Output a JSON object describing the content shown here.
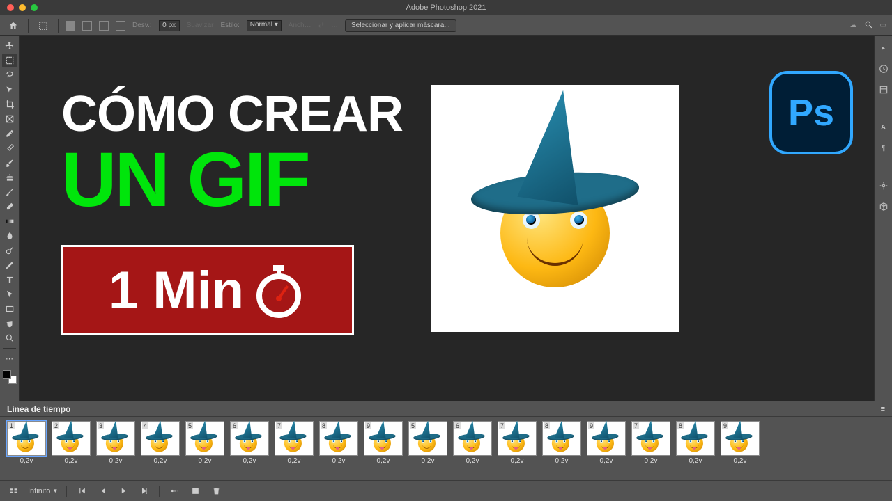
{
  "app_title": "Adobe Photoshop 2021",
  "options_bar": {
    "desv_label": "Desv.:",
    "desv_value": "0 px",
    "suavizar": "Suavizar",
    "estilo_label": "Estilo:",
    "estilo_value": "Normal",
    "anch_label": "Anch…",
    "mask_button": "Seleccionar y aplicar máscara..."
  },
  "overlay": {
    "line1": "CÓMO CREAR",
    "line2": "UN GIF",
    "badge": "1 Min",
    "ps_logo": "Ps"
  },
  "right_panel_icons": [
    "history",
    "properties",
    "type",
    "paragraph",
    "navigator",
    "3d"
  ],
  "timeline": {
    "title": "Línea de tiempo",
    "frames": [
      {
        "n": "1",
        "delay": "0,2v",
        "sel": true,
        "tongue": false
      },
      {
        "n": "2",
        "delay": "0,2v",
        "tongue": true
      },
      {
        "n": "3",
        "delay": "0,2v",
        "tongue": true
      },
      {
        "n": "4",
        "delay": "0,2v",
        "tongue": false
      },
      {
        "n": "5",
        "delay": "0,2v",
        "tongue": true
      },
      {
        "n": "6",
        "delay": "0,2v",
        "tongue": true
      },
      {
        "n": "7",
        "delay": "0,2v",
        "tongue": true
      },
      {
        "n": "8",
        "delay": "0,2v",
        "tongue": true
      },
      {
        "n": "9",
        "delay": "0,2v",
        "tongue": true
      },
      {
        "n": "5",
        "delay": "0,2v",
        "tongue": false
      },
      {
        "n": "6",
        "delay": "0,2v",
        "tongue": true
      },
      {
        "n": "7",
        "delay": "0,2v",
        "tongue": true
      },
      {
        "n": "8",
        "delay": "0,2v",
        "tongue": true
      },
      {
        "n": "9",
        "delay": "0,2v",
        "tongue": true
      },
      {
        "n": "7",
        "delay": "0,2v",
        "tongue": true
      },
      {
        "n": "8",
        "delay": "0,2v",
        "tongue": true
      },
      {
        "n": "9",
        "delay": "0,2v",
        "tongue": true
      }
    ],
    "loop": "Infinito"
  }
}
